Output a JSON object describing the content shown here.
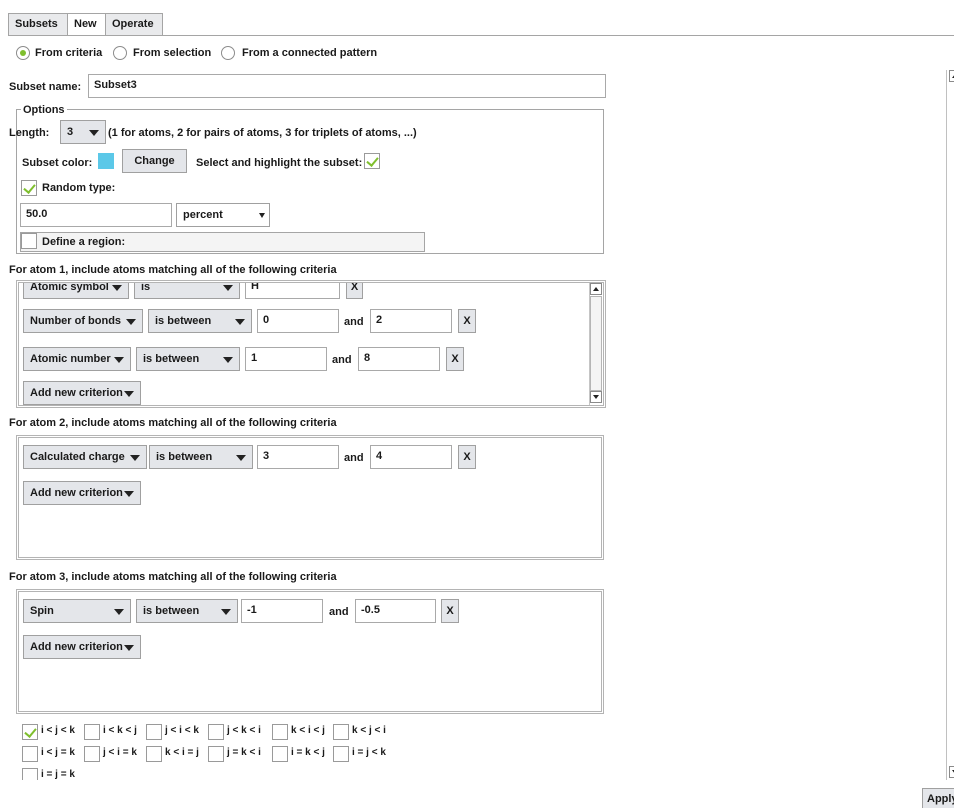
{
  "tabs": [
    {
      "label": "Subsets"
    },
    {
      "label": "New"
    },
    {
      "label": "Operate"
    }
  ],
  "source": {
    "from_criteria": "From criteria",
    "from_selection": "From selection",
    "from_pattern": "From a connected pattern",
    "selected": "From criteria"
  },
  "subset_name": {
    "label": "Subset name:",
    "value": "Subset3"
  },
  "options": {
    "legend": "Options",
    "length_label": "Length:",
    "length_value": "3",
    "length_hint": "(1 for atoms, 2 for pairs of atoms, 3 for triplets of atoms, ...)",
    "color_label": "Subset color:",
    "color_value": "#5bc8e8",
    "change_button": "Change",
    "highlight_label": "Select and highlight the subset:",
    "highlight_checked": true,
    "random_label": "Random type:",
    "random_checked": true,
    "random_value": "50.0",
    "random_unit": "percent",
    "region_label": "Define a region:",
    "region_checked": false
  },
  "atoms": [
    {
      "title": "For atom 1, include atoms matching all of the following criteria",
      "criteria": [
        {
          "property": "Atomic symbol",
          "op": "is",
          "v1": "H",
          "remove": "X"
        },
        {
          "property": "Number of bonds",
          "op": "is between",
          "v1": "0",
          "and": "and",
          "v2": "2",
          "remove": "X"
        },
        {
          "property": "Atomic number",
          "op": "is between",
          "v1": "1",
          "and": "and",
          "v2": "8",
          "remove": "X"
        }
      ],
      "add_label": "Add new criterion"
    },
    {
      "title": "For atom 2, include atoms matching all of the following criteria",
      "criteria": [
        {
          "property": "Calculated charge",
          "op": "is between",
          "v1": "3",
          "and": "and",
          "v2": "4",
          "remove": "X"
        }
      ],
      "add_label": "Add new criterion"
    },
    {
      "title": "For atom 3, include atoms matching all of the following criteria",
      "criteria": [
        {
          "property": "Spin",
          "op": "is between",
          "v1": "-1",
          "and": "and",
          "v2": "-0.5",
          "remove": "X"
        }
      ],
      "add_label": "Add new criterion"
    }
  ],
  "orderings": [
    {
      "label": "i < j < k",
      "checked": true
    },
    {
      "label": "i < k < j",
      "checked": false
    },
    {
      "label": "j < i < k",
      "checked": false
    },
    {
      "label": "j < k < i",
      "checked": false
    },
    {
      "label": "k < i < j",
      "checked": false
    },
    {
      "label": "k < j < i",
      "checked": false
    },
    {
      "label": "i < j = k",
      "checked": false
    },
    {
      "label": "j < i = k",
      "checked": false
    },
    {
      "label": "k < i = j",
      "checked": false
    },
    {
      "label": "j = k < i",
      "checked": false
    },
    {
      "label": "i = k < j",
      "checked": false
    },
    {
      "label": "i = j < k",
      "checked": false
    },
    {
      "label": "i = j = k",
      "checked": false
    }
  ],
  "apply_button": "Apply"
}
